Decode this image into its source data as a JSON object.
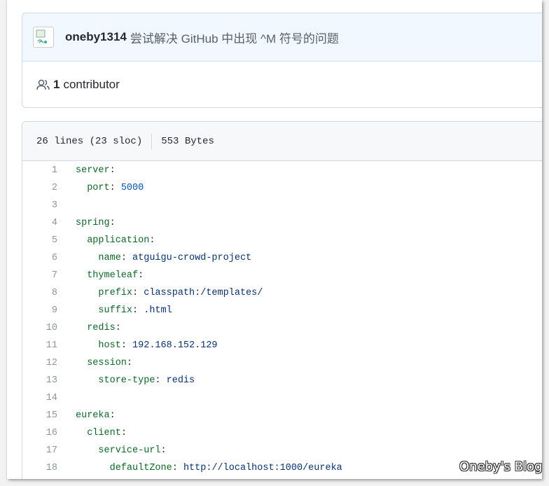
{
  "commit": {
    "author": "oneby1314",
    "message": "尝试解决 GitHub 中出现 ^M 符号的问题"
  },
  "contributors": {
    "count": "1",
    "label": "contributor"
  },
  "file": {
    "lines_info": "26 lines (23 sloc)",
    "size": "553 Bytes"
  },
  "code_lines": [
    {
      "n": "1",
      "indent": "",
      "key": "server",
      "sep": ":",
      "val": "",
      "val_type": ""
    },
    {
      "n": "2",
      "indent": "  ",
      "key": "port",
      "sep": ": ",
      "val": "5000",
      "val_type": "num"
    },
    {
      "n": "3",
      "indent": "",
      "key": "",
      "sep": "",
      "val": "",
      "val_type": ""
    },
    {
      "n": "4",
      "indent": "",
      "key": "spring",
      "sep": ":",
      "val": "",
      "val_type": ""
    },
    {
      "n": "5",
      "indent": "  ",
      "key": "application",
      "sep": ":",
      "val": "",
      "val_type": ""
    },
    {
      "n": "6",
      "indent": "    ",
      "key": "name",
      "sep": ": ",
      "val": "atguigu-crowd-project",
      "val_type": "str"
    },
    {
      "n": "7",
      "indent": "  ",
      "key": "thymeleaf",
      "sep": ":",
      "val": "",
      "val_type": ""
    },
    {
      "n": "8",
      "indent": "    ",
      "key": "prefix",
      "sep": ": ",
      "val": "classpath:/templates/",
      "val_type": "str"
    },
    {
      "n": "9",
      "indent": "    ",
      "key": "suffix",
      "sep": ": ",
      "val": ".html",
      "val_type": "str"
    },
    {
      "n": "10",
      "indent": "  ",
      "key": "redis",
      "sep": ":",
      "val": "",
      "val_type": ""
    },
    {
      "n": "11",
      "indent": "    ",
      "key": "host",
      "sep": ": ",
      "val": "192.168.152.129",
      "val_type": "str"
    },
    {
      "n": "12",
      "indent": "  ",
      "key": "session",
      "sep": ":",
      "val": "",
      "val_type": ""
    },
    {
      "n": "13",
      "indent": "    ",
      "key": "store-type",
      "sep": ": ",
      "val": "redis",
      "val_type": "str"
    },
    {
      "n": "14",
      "indent": "",
      "key": "",
      "sep": "",
      "val": "",
      "val_type": ""
    },
    {
      "n": "15",
      "indent": "",
      "key": "eureka",
      "sep": ":",
      "val": "",
      "val_type": ""
    },
    {
      "n": "16",
      "indent": "  ",
      "key": "client",
      "sep": ":",
      "val": "",
      "val_type": ""
    },
    {
      "n": "17",
      "indent": "    ",
      "key": "service-url",
      "sep": ":",
      "val": "",
      "val_type": ""
    },
    {
      "n": "18",
      "indent": "      ",
      "key": "defaultZone",
      "sep": ": ",
      "val": "http://localhost:1000/eureka",
      "val_type": "str"
    }
  ],
  "icons": {
    "avatar": "broken-image-icon",
    "contributors": "people-icon"
  },
  "colors": {
    "commit_bg": "#f1f8ff",
    "yaml_key": "#116329",
    "yaml_string": "#0a3069",
    "yaml_number": "#0550ae",
    "line_number": "#8c959f"
  },
  "watermark": "Oneby's Blog"
}
